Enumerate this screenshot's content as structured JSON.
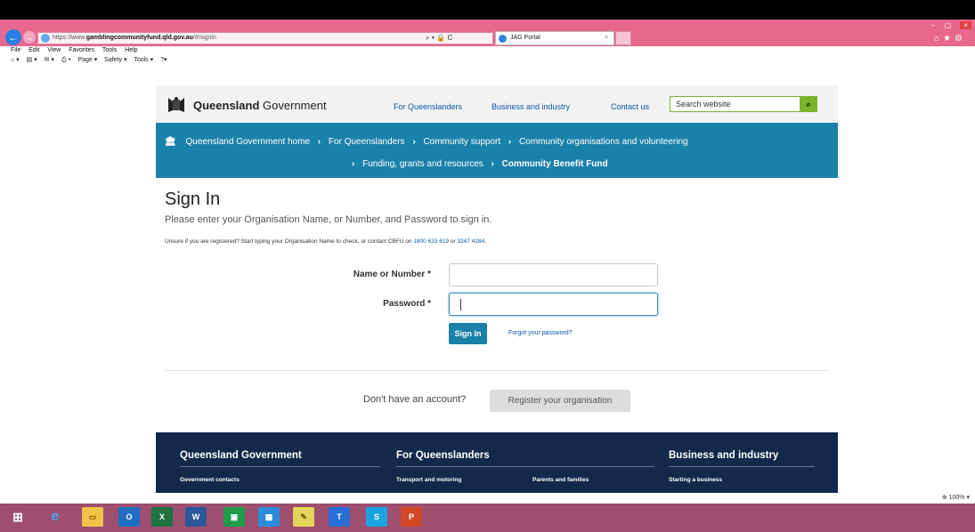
{
  "browser": {
    "url_prefix": "https://www.",
    "url_domain": "gamblingcommunityfund.qld.gov.au",
    "url_path": "/#/signin",
    "addr_tools": "⌕ ▾ 🔒 C",
    "tab_title": "JAG Portal",
    "tab_close": "×",
    "menu": [
      "File",
      "Edit",
      "View",
      "Favorites",
      "Tools",
      "Help"
    ],
    "commands": [
      "Page ▾",
      "Safety ▾",
      "Tools ▾"
    ],
    "zoom": "100%",
    "window_controls": [
      "–",
      "▢",
      "×"
    ]
  },
  "header": {
    "brand_bold": "Queensland",
    "brand_regular": "Government",
    "nav": [
      "For Queenslanders",
      "Business and industry",
      "Contact us"
    ],
    "search_placeholder": "Search website",
    "search_icon": "search-icon"
  },
  "breadcrumbs": {
    "row1": [
      "Queensland Government home",
      "For Queenslanders",
      "Community support",
      "Community organisations and volunteering"
    ],
    "row2": [
      "Funding, grants and resources",
      "Community Benefit Fund"
    ],
    "separator": "›"
  },
  "signin": {
    "title": "Sign In",
    "subtitle": "Please enter your Organisation Name, or Number, and Password to sign in.",
    "note_prefix": "Unsure if you are registered? Start typing your Organisation Name to check, or contact CBFU on",
    "phone1": "1800 633 619",
    "or": "or",
    "phone2": "3247 4284",
    "name_label": "Name or Number *",
    "password_label": "Password *",
    "button": "Sign In",
    "forgot": "Forgot your password?",
    "no_account": "Don't have an account?",
    "register": "Register your organisation"
  },
  "footer": {
    "columns": [
      {
        "title": "Queensland Government",
        "link": "Government contacts"
      },
      {
        "title": "For Queenslanders",
        "link": "Transport and motoring"
      },
      {
        "title": "",
        "link": "Parents and families"
      },
      {
        "title": "Business and industry",
        "link": "Starting a business"
      }
    ]
  },
  "taskbar": {
    "apps": [
      "windows-start",
      "internet-explorer",
      "file-explorer",
      "outlook",
      "excel",
      "word",
      "store",
      "windows-store",
      "sticky",
      "telstra",
      "skype",
      "powerpoint"
    ]
  },
  "colors": {
    "titlebar": "#e8678f",
    "crumb_bg": "#1a81a9",
    "footer_bg": "#13294b",
    "search_green": "#78b52b",
    "link_blue": "#0b57a4"
  }
}
